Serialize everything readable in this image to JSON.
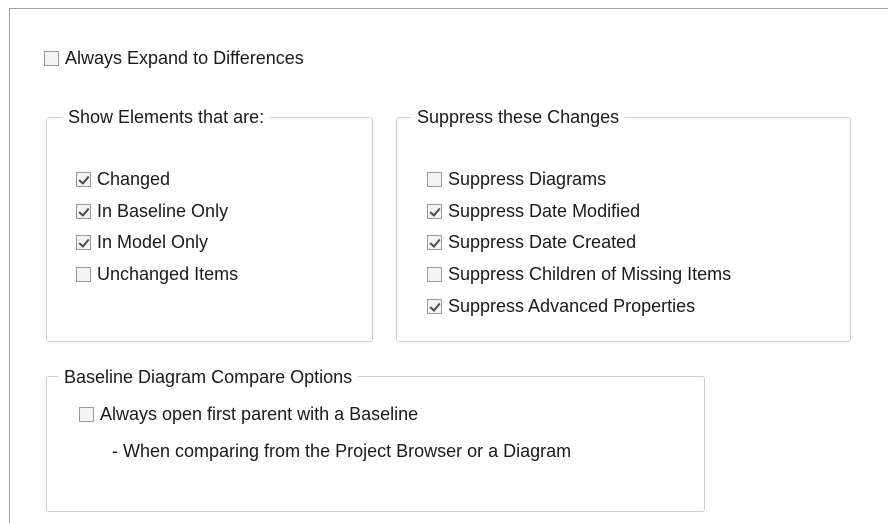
{
  "top": {
    "always_expand": {
      "label": "Always Expand to Differences",
      "checked": false
    }
  },
  "show_elements": {
    "legend": "Show Elements that are:",
    "items": [
      {
        "label": "Changed",
        "checked": true
      },
      {
        "label": "In Baseline Only",
        "checked": true
      },
      {
        "label": "In Model Only",
        "checked": true
      },
      {
        "label": "Unchanged Items",
        "checked": false
      }
    ]
  },
  "suppress": {
    "legend": "Suppress these Changes",
    "items": [
      {
        "label": "Suppress Diagrams",
        "checked": false
      },
      {
        "label": "Suppress Date Modified",
        "checked": true
      },
      {
        "label": "Suppress Date Created",
        "checked": true
      },
      {
        "label": "Suppress Children of Missing Items",
        "checked": false
      },
      {
        "label": "Suppress Advanced Properties",
        "checked": true
      }
    ]
  },
  "diagram_options": {
    "legend": "Baseline Diagram Compare Options",
    "always_open": {
      "label": "Always open first parent with a Baseline",
      "checked": false
    },
    "note": "- When comparing from the Project Browser or a Diagram"
  }
}
